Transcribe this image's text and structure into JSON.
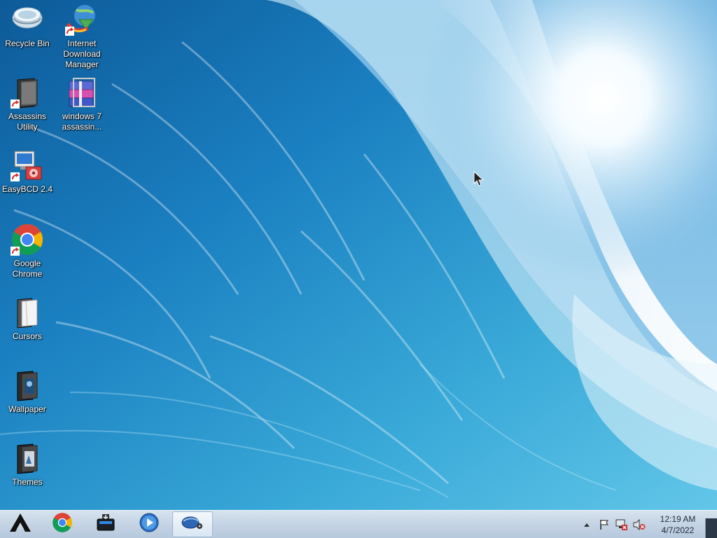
{
  "desktop": {
    "icons": [
      {
        "label": "Recycle Bin",
        "icon": "recycle-bin-icon"
      },
      {
        "label": "Internet\nDownload\nManager",
        "icon": "idm-icon"
      },
      {
        "label": "Assassins\nUtility",
        "icon": "folder-dark-icon"
      },
      {
        "label": "windows 7\nassassin...",
        "icon": "winrar-archive-icon"
      },
      {
        "label": "EasyBCD 2.4",
        "icon": "easybcd-icon"
      },
      {
        "label": "Google\nChrome",
        "icon": "chrome-icon"
      },
      {
        "label": "Cursors",
        "icon": "folder-white-icon"
      },
      {
        "label": "Wallpaper",
        "icon": "folder-dark-icon"
      },
      {
        "label": "Themes",
        "icon": "folder-dark-icon"
      }
    ]
  },
  "taskbar": {
    "pinned": [
      {
        "name": "start-button",
        "icon": "start-logo-icon"
      },
      {
        "name": "chrome",
        "icon": "chrome-icon"
      },
      {
        "name": "file-explorer",
        "icon": "drive-icon"
      },
      {
        "name": "media-player",
        "icon": "media-player-icon"
      },
      {
        "name": "active-window",
        "icon": "mouse-settings-icon"
      }
    ],
    "tray": {
      "icons": [
        "show-hidden-icons-arrow",
        "action-center-flag-icon",
        "network-disconnected-icon",
        "volume-muted-icon"
      ],
      "time": "12:19 AM",
      "date": "4/7/2022"
    }
  },
  "colors": {
    "taskbar_top": "#d8e3ee",
    "taskbar_bottom": "#b6c9dd",
    "wave_deep": "#0f5f9e",
    "wave_light": "#5fc3e6",
    "sky": "#7fbde6"
  }
}
